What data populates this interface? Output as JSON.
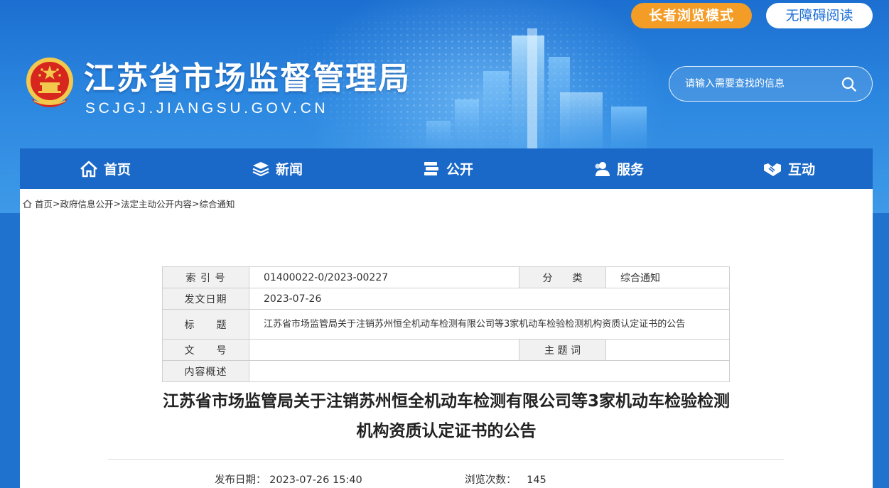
{
  "header": {
    "site_title": "江苏省市场监督管理局",
    "site_domain": "SCJGJ.JIANGSU.GOV.CN",
    "elder_mode_label": "长者浏览模式",
    "accessibility_label": "无障碍阅读",
    "search_placeholder": "请输入需要查找的信息"
  },
  "nav": {
    "items": [
      {
        "label": "首页",
        "icon": "home-icon"
      },
      {
        "label": "新闻",
        "icon": "layers-icon"
      },
      {
        "label": "公开",
        "icon": "books-icon"
      },
      {
        "label": "服务",
        "icon": "users-icon"
      },
      {
        "label": "互动",
        "icon": "handshake-icon"
      }
    ]
  },
  "breadcrumb": {
    "items": [
      "首页",
      "政府信息公开",
      "法定主动公开内容",
      "综合通知"
    ],
    "separator": ">"
  },
  "meta_table": {
    "index_label": "索 引 号",
    "index_value": "01400022-0/2023-00227",
    "category_label": "分　　类",
    "category_value": "综合通知",
    "date_label": "发文日期",
    "date_value": "2023-07-26",
    "title_label": "标　　题",
    "title_value": "江苏省市场监管局关于注销苏州恒全机动车检测有限公司等3家机动车检验检测机构资质认定证书的公告",
    "doc_no_label": "文　　号",
    "doc_no_value": "",
    "keywords_label": "主 题 词",
    "keywords_value": "",
    "summary_label": "内容概述",
    "summary_value": ""
  },
  "article": {
    "title_line1": "江苏省市场监管局关于注销苏州恒全机动车检测有限公司等3家机动车检验检测",
    "title_line2": "机构资质认定证书的公告",
    "publish_label": "发布日期：",
    "publish_value": "2023-07-26 15:40",
    "views_label": "浏览次数：",
    "views_value": "145"
  },
  "colors": {
    "banner_blue": "#2b86df",
    "nav_blue": "#1a68c7",
    "elder_orange": "#f39c26",
    "emblem_red": "#d7261e",
    "emblem_gold": "#f2c94c"
  }
}
